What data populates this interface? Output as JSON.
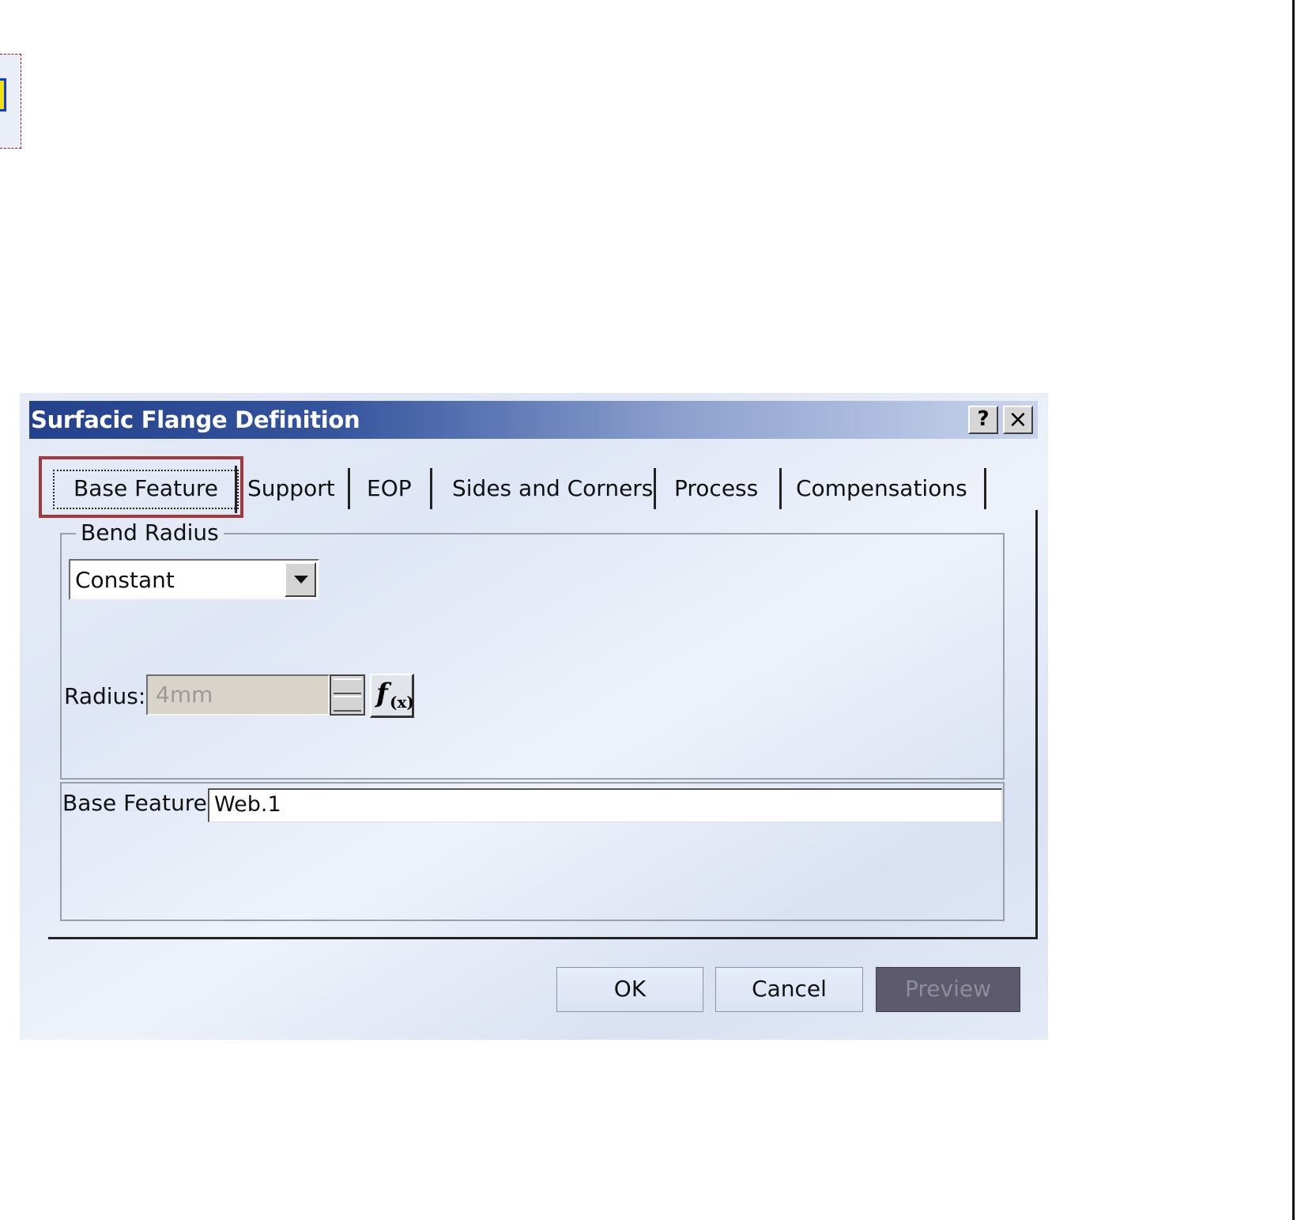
{
  "dialog": {
    "title": "Surfacic Flange Definition",
    "help_label": "?",
    "close_label": "×"
  },
  "tabs": [
    {
      "label": "Base Feature",
      "active": true
    },
    {
      "label": "Support"
    },
    {
      "label": "EOP"
    },
    {
      "label": "Sides and Corners"
    },
    {
      "label": "Process"
    },
    {
      "label": "Compensations"
    }
  ],
  "bend_radius": {
    "group_label": "Bend Radius",
    "mode_selected": "Constant",
    "radius_label": "Radius:",
    "radius_value": "4mm",
    "formula_label": "f(x)"
  },
  "base_feature": {
    "label": "Base Feature:",
    "value": "Web.1"
  },
  "buttons": {
    "ok": "OK",
    "cancel": "Cancel",
    "preview": "Preview"
  },
  "colors": {
    "highlight": "#a13a3e",
    "titlebar_start": "#24418c",
    "titlebar_end": "#c9d4ec"
  }
}
